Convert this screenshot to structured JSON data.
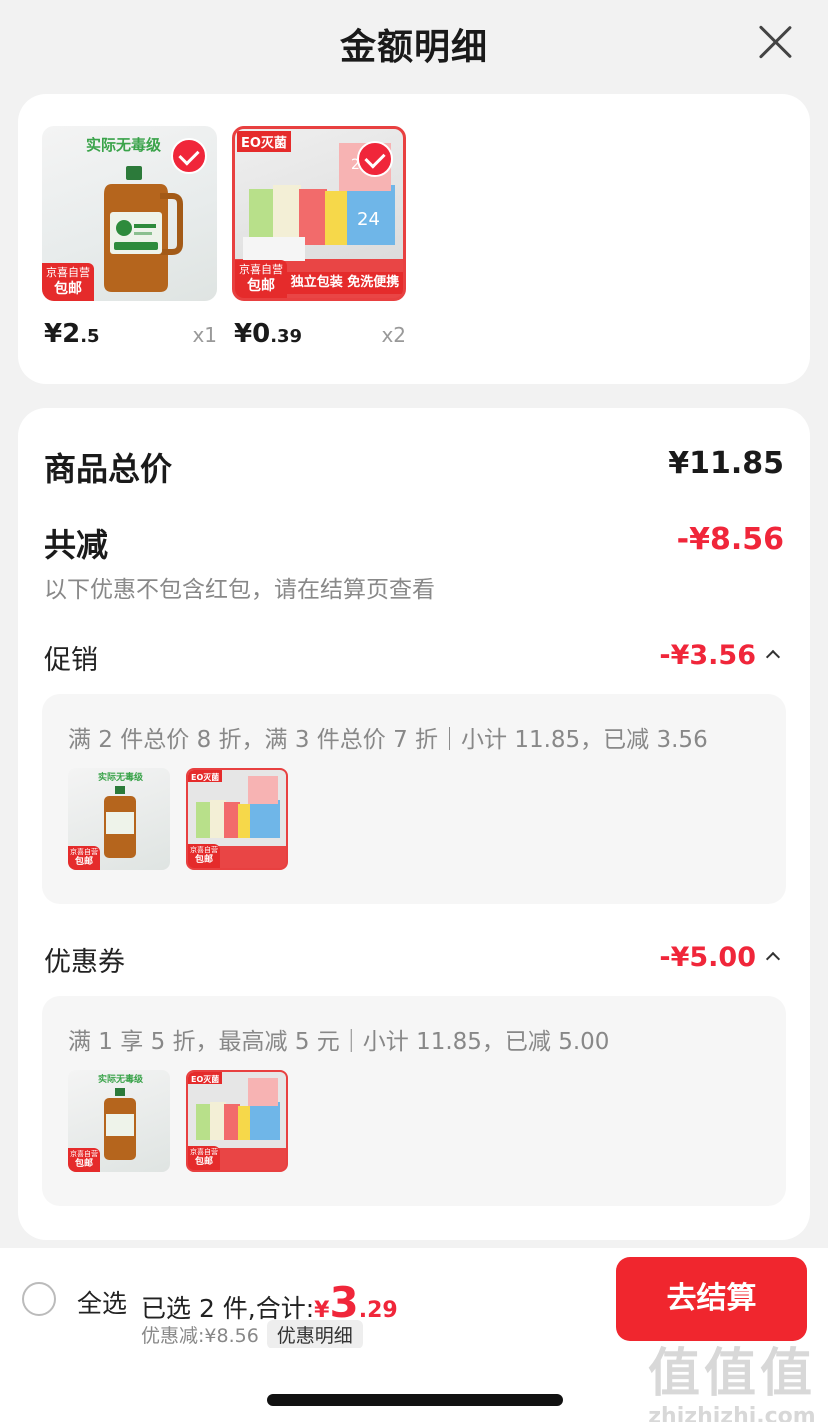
{
  "header": {
    "title": "金额明细"
  },
  "products": [
    {
      "price_int": "¥2",
      "price_dec": ".5",
      "qty": "x1",
      "tag_top": "京喜自营",
      "tag_bottom": "包邮",
      "img_text": "实际无毒级"
    },
    {
      "price_int": "¥0",
      "price_dec": ".39",
      "qty": "x2",
      "tag_top": "京喜自营",
      "tag_bottom": "包邮",
      "img_text": "EO灭菌",
      "img_banner": "独立包装 免洗便携"
    }
  ],
  "summary": {
    "total_label": "商品总价",
    "total_value": "¥11.85",
    "reduce_label": "共减",
    "reduce_value": "-¥8.56",
    "note": "以下优惠不包含红包，请在结算页查看"
  },
  "promotion": {
    "label": "促销",
    "value": "-¥3.56",
    "detail": "满 2 件总价 8 折，满 3 件总价 7 折｜小计 11.85，已减 3.56"
  },
  "coupon": {
    "label": "优惠券",
    "value": "-¥5.00",
    "detail": "满 1 享 5 折，最高减 5 元｜小计 11.85，已减 5.00"
  },
  "footer": {
    "select_all": "全选",
    "selected_prefix": "已选 2 件,合计:",
    "total_symbol": "¥",
    "total_int": "3",
    "total_dec": ".29",
    "discount": "优惠减:¥8.56",
    "detail_button": "优惠明细",
    "checkout": "去结算"
  },
  "watermark": {
    "logo": "值值值",
    "domain": "zhizhizhi.com"
  },
  "colors": {
    "accent": "#f0263a",
    "checkout": "#f0262e"
  }
}
